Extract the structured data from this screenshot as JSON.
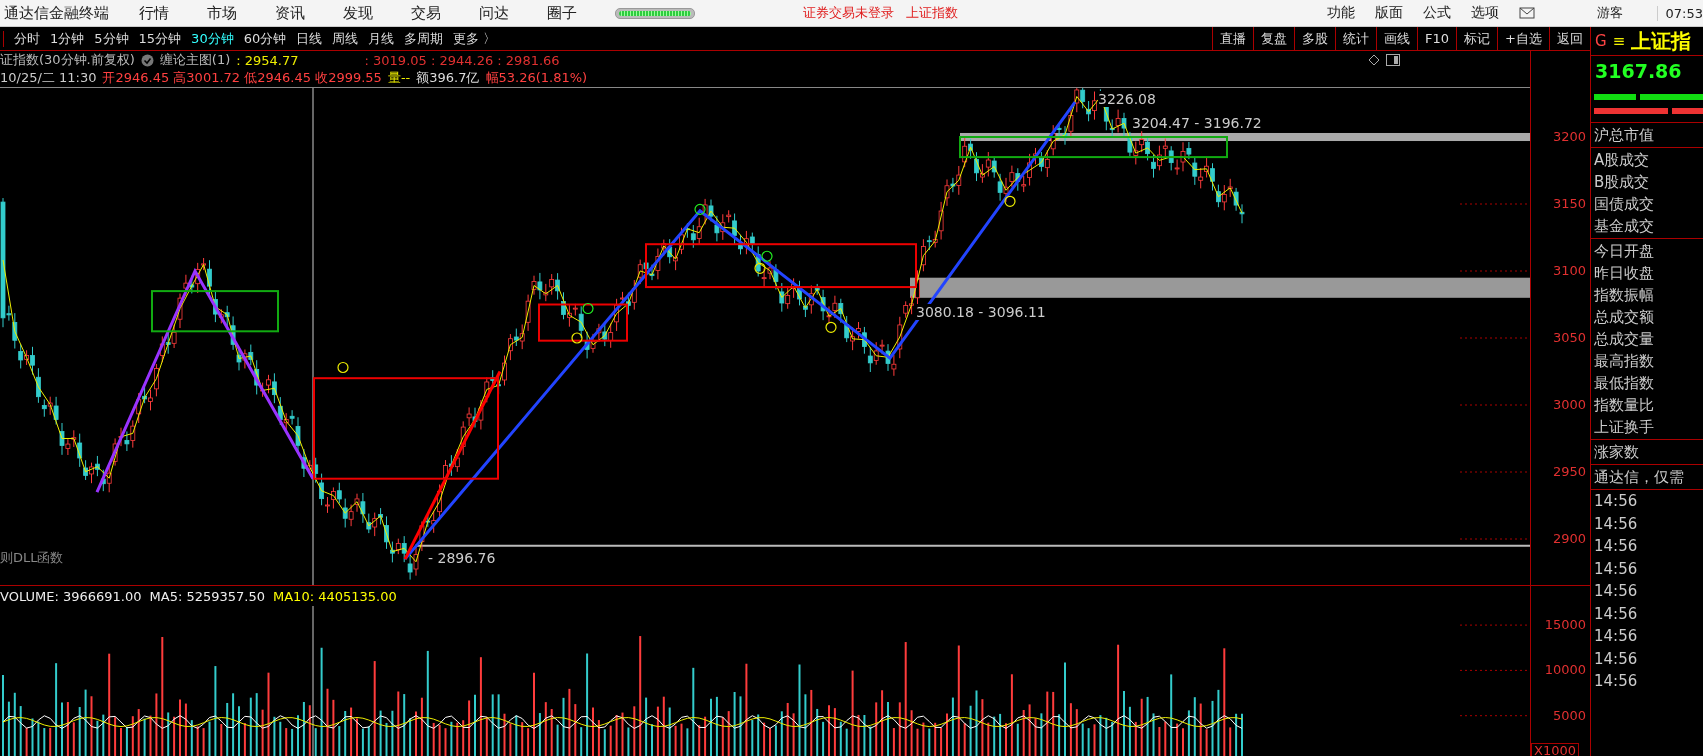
{
  "menu_bar": {
    "items": [
      "通达信金融终端",
      "行情",
      "市场",
      "资讯",
      "发现",
      "交易",
      "问达",
      "圈子"
    ],
    "status": [
      "证券交易未登录",
      "上证指数"
    ],
    "right_items": [
      "功能",
      "版面",
      "公式",
      "选项"
    ],
    "user": "游客",
    "clock": "07:53"
  },
  "toolbar": {
    "periods": [
      {
        "label": "分时",
        "selected": false
      },
      {
        "label": "1分钟",
        "selected": false
      },
      {
        "label": "5分钟",
        "selected": false
      },
      {
        "label": "15分钟",
        "selected": false
      },
      {
        "label": "30分钟",
        "selected": true
      },
      {
        "label": "60分钟",
        "selected": false
      },
      {
        "label": "日线",
        "selected": false
      },
      {
        "label": "周线",
        "selected": false
      },
      {
        "label": "月线",
        "selected": false
      },
      {
        "label": "多周期",
        "selected": false
      },
      {
        "label": "更多 〉",
        "selected": false
      }
    ],
    "buttons": [
      "直播",
      "复盘",
      "多股",
      "统计",
      "画线",
      "F10",
      "标记",
      "+自选",
      "返回"
    ]
  },
  "chart_header": {
    "title": "证指数(30分钟.前复权)",
    "indicator": "缠论主图(1)",
    "value": ": 2954.77",
    "values": ": 3019.05 : 2944.26 : 2981.66"
  },
  "bar_info": [
    {
      "kind": "date",
      "text": "10/25/二 11:30"
    },
    {
      "kind": "price",
      "text": "开2946.45 高3001.72 低2946.45 收2999.55"
    },
    {
      "kind": "volume",
      "text": "量--"
    },
    {
      "kind": "amount",
      "text": "额396.7亿"
    },
    {
      "kind": "price",
      "text": "幅53.26(1.81%)"
    }
  ],
  "price_chart": {
    "annotations": [
      "3226.08",
      "3204.47 - 3196.72",
      "3080.18 - 3096.11",
      "- 2896.76"
    ],
    "footer": "则DLL函数",
    "axis": [
      "3200",
      "3150",
      "3100",
      "3050",
      "3000",
      "2950",
      "2900"
    ]
  },
  "volume_chart": {
    "legend": [
      {
        "kind": "volume",
        "text": "VOLUME: 3966691.00"
      },
      {
        "kind": "ma5",
        "text": "MA5: 5259357.50"
      },
      {
        "kind": "ma10",
        "text": "MA10: 4405135.00"
      }
    ],
    "axis": [
      "15000",
      "10000",
      "5000"
    ],
    "unit": "X1000"
  },
  "quote_panel": {
    "code_mark": "G",
    "menu_mark": "≡",
    "name": "上证指",
    "price": "3167.86",
    "sections": [
      [
        "沪总市值"
      ],
      [
        "A股成交",
        "B股成交",
        "国债成交",
        "基金成交"
      ],
      [
        "今日开盘",
        "昨日收盘",
        "指数振幅",
        "总成交额",
        "总成交量",
        "最高指数",
        "最低指数",
        "指数量比",
        "上证换手"
      ],
      [
        "涨家数"
      ],
      [
        "通达信，仅需"
      ]
    ],
    "times": [
      "14:56",
      "14:56",
      "14:56",
      "14:56",
      "14:56",
      "14:56",
      "14:56",
      "14:56",
      "14:56"
    ]
  }
}
